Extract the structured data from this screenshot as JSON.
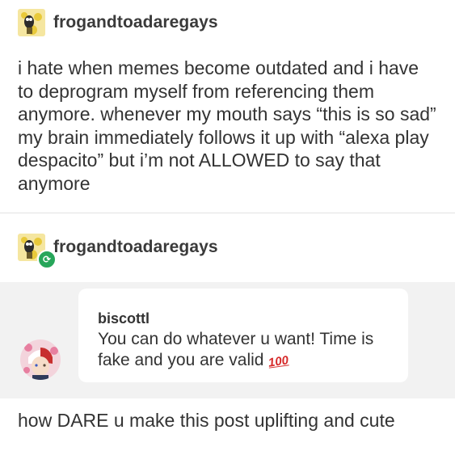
{
  "post": {
    "author": "frogandtoadaregays",
    "text": "i hate when memes become outdated and i have to deprogram myself from referencing them anymore. whenever my mouth says “this is so sad” my brain immediately follows it up with “alexa play despacito” but i’m not ALLOWED to say that anymore"
  },
  "reblog": {
    "author": "frogandtoadaregays",
    "reply": {
      "name": "biscottl",
      "text": "You can do whatever u want! Time is fake and you are valid",
      "emoji_label": "100"
    },
    "comment": "how DARE u make this post uplifting and cute"
  },
  "icons": {
    "avatar": "frog-toad-avatar-icon",
    "reblog": "reblog-icon",
    "reply_avatar": "anime-avatar-icon"
  },
  "colors": {
    "reply_background": "#f2f2f2",
    "reblog_badge": "#27a65a",
    "emoji_red": "#d62a2a"
  }
}
